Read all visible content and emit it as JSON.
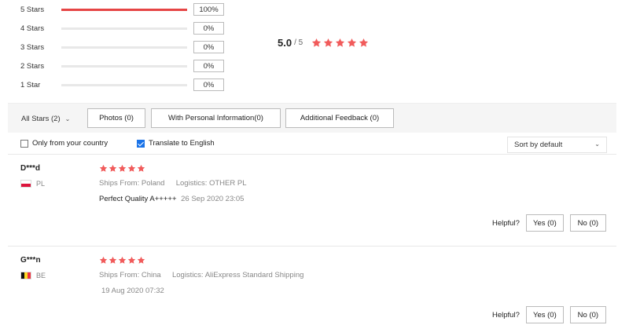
{
  "summary": {
    "rows": [
      {
        "label": "5 Stars",
        "percent": "100%",
        "fill": 1.0
      },
      {
        "label": "4 Stars",
        "percent": "0%",
        "fill": 0
      },
      {
        "label": "3 Stars",
        "percent": "0%",
        "fill": 0
      },
      {
        "label": "2 Stars",
        "percent": "0%",
        "fill": 0
      },
      {
        "label": "1 Star",
        "percent": "0%",
        "fill": 0
      }
    ],
    "overall_score": "5.0",
    "overall_max": "/ 5",
    "overall_stars": 5
  },
  "filters": {
    "all_stars": "All Stars (2)",
    "photos": "Photos (0)",
    "personal_info": "With Personal Information(0)",
    "additional_feedback": "Additional Feedback (0)"
  },
  "options": {
    "only_country": "Only from your country",
    "only_country_checked": false,
    "translate": "Translate to English",
    "translate_checked": true,
    "sort": "Sort by default"
  },
  "reviews": [
    {
      "name": "D***d",
      "country": "PL",
      "stars": 5,
      "ships_from_label": "Ships From:",
      "ships_from": "Poland",
      "logistics_label": "Logistics:",
      "logistics": "OTHER PL",
      "feedback": "Perfect Quality A+++++",
      "date": "26 Sep 2020 23:05",
      "helpful_label": "Helpful?",
      "yes": "Yes (0)",
      "no": "No (0)"
    },
    {
      "name": "G***n",
      "country": "BE",
      "stars": 5,
      "ships_from_label": "Ships From:",
      "ships_from": "China",
      "logistics_label": "Logistics:",
      "logistics": "AliExpress Standard Shipping",
      "feedback": "",
      "date": "19 Aug 2020 07:32",
      "helpful_label": "Helpful?",
      "yes": "Yes (0)",
      "no": "No (0)"
    }
  ],
  "colors": {
    "star": "#f15b5b",
    "bar_fill": "#e64545",
    "bar_track": "#e8e8e8",
    "checkbox_checked": "#1a73e8"
  },
  "icons": {
    "star": "star-icon",
    "chevron": "chevron-down-icon",
    "flag_pl": "flag-poland-icon",
    "flag_be": "flag-belgium-icon"
  }
}
